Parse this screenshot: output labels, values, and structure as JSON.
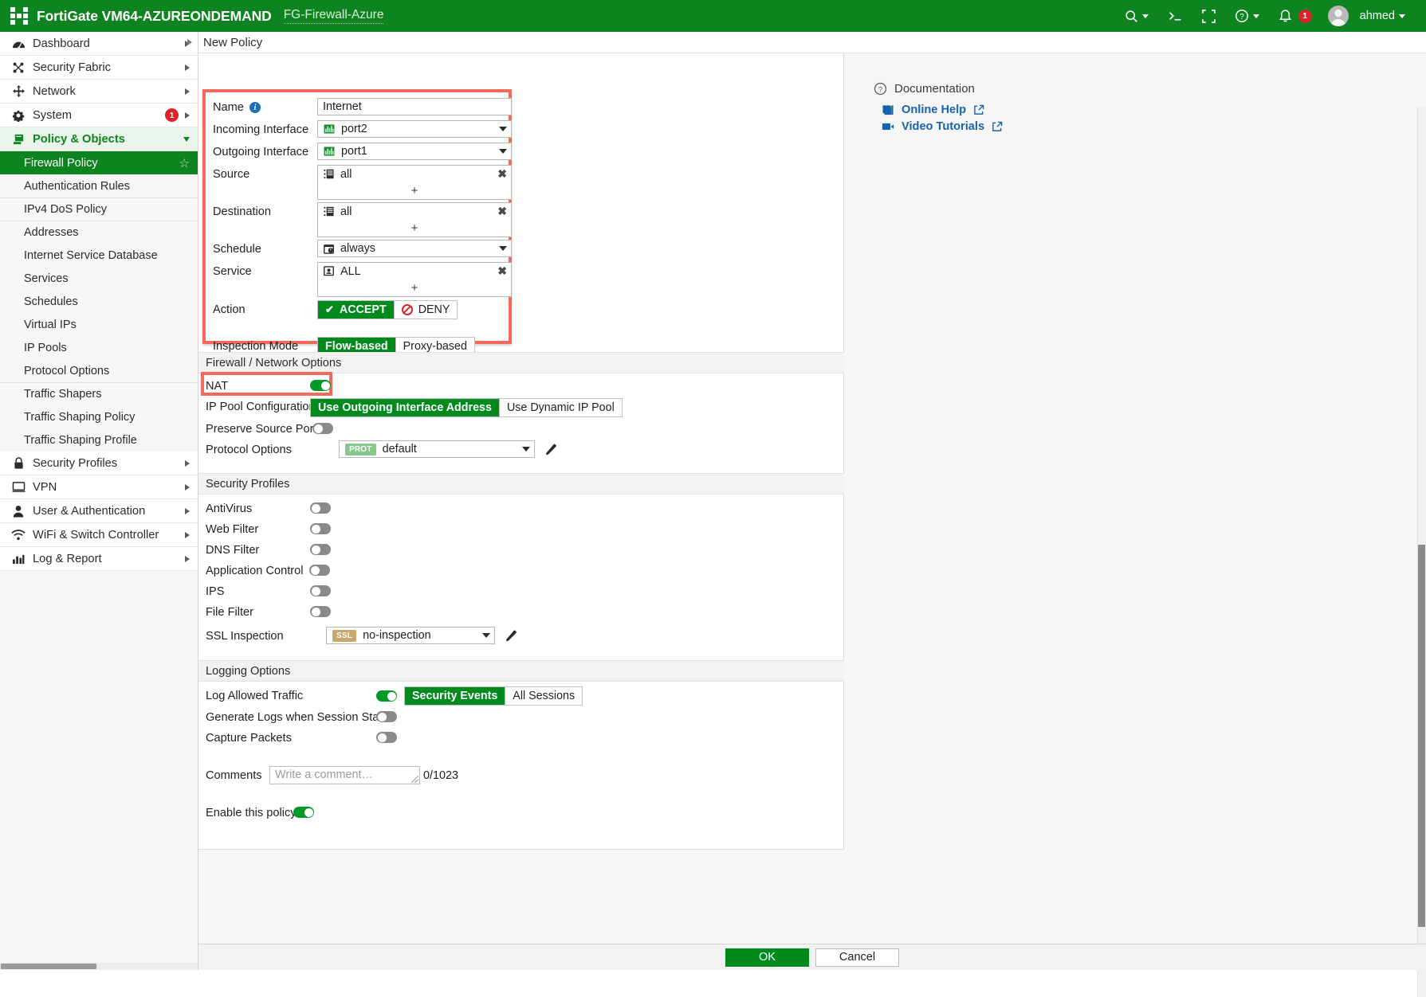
{
  "topbar": {
    "brand": "FortiGate VM64-AZUREONDEMAND",
    "hostname": "FG-Firewall-Azure",
    "search_icon": "search-icon",
    "cli_icon": "cli-console-icon",
    "fullscreen_icon": "fullscreen-icon",
    "help_icon": "help-icon",
    "notification_icon": "bell-icon",
    "notification_count": "1",
    "user_name": "ahmed"
  },
  "sidebar": {
    "top_items": [
      {
        "label": "Dashboard",
        "icon": "dashboard-icon",
        "expandable": true
      },
      {
        "label": "Security Fabric",
        "icon": "security-fabric-icon",
        "expandable": true
      },
      {
        "label": "Network",
        "icon": "network-icon",
        "expandable": true
      },
      {
        "label": "System",
        "icon": "gear-icon",
        "expandable": true,
        "badge": "1"
      },
      {
        "label": "Policy & Objects",
        "icon": "policy-objects-icon",
        "expanded": true
      }
    ],
    "sub_items": [
      {
        "label": "Firewall Policy",
        "selected": true,
        "star": "☆"
      },
      {
        "label": "Authentication Rules"
      },
      {
        "label": "IPv4 DoS Policy"
      },
      {
        "label": "Addresses"
      },
      {
        "label": "Internet Service Database"
      },
      {
        "label": "Services"
      },
      {
        "label": "Schedules"
      },
      {
        "label": "Virtual IPs"
      },
      {
        "label": "IP Pools"
      },
      {
        "label": "Protocol Options"
      },
      {
        "label": "Traffic Shapers"
      },
      {
        "label": "Traffic Shaping Policy"
      },
      {
        "label": "Traffic Shaping Profile"
      }
    ],
    "bottom_items": [
      {
        "label": "Security Profiles",
        "icon": "lock-icon",
        "expandable": true
      },
      {
        "label": "VPN",
        "icon": "monitor-icon",
        "expandable": true
      },
      {
        "label": "User & Authentication",
        "icon": "user-icon",
        "expandable": true
      },
      {
        "label": "WiFi & Switch Controller",
        "icon": "wifi-icon",
        "expandable": true
      },
      {
        "label": "Log & Report",
        "icon": "chart-bars-icon",
        "expandable": true
      }
    ]
  },
  "page": {
    "title": "New Policy"
  },
  "form": {
    "name_label": "Name",
    "name_value": "Internet",
    "incoming_label": "Incoming Interface",
    "incoming_value": "port2",
    "outgoing_label": "Outgoing Interface",
    "outgoing_value": "port1",
    "source_label": "Source",
    "source_value": "all",
    "destination_label": "Destination",
    "destination_value": "all",
    "schedule_label": "Schedule",
    "schedule_value": "always",
    "service_label": "Service",
    "service_value": "ALL",
    "action_label": "Action",
    "action_accept": "ACCEPT",
    "action_deny": "DENY",
    "action_selected": "ACCEPT",
    "inspection_label": "Inspection Mode",
    "inspection_flow": "Flow-based",
    "inspection_proxy": "Proxy-based",
    "inspection_selected": "Flow-based",
    "add_glyph": "+",
    "remove_glyph": "✖"
  },
  "network_options": {
    "section_title": "Firewall / Network Options",
    "nat_label": "NAT",
    "nat_on": true,
    "ip_pool_label": "IP Pool Configuration",
    "ip_pool_opt1": "Use Outgoing Interface Address",
    "ip_pool_opt2": "Use Dynamic IP Pool",
    "ip_pool_selected": "Use Outgoing Interface Address",
    "preserve_label": "Preserve Source Port",
    "preserve_on": false,
    "protocol_label": "Protocol Options",
    "protocol_tag": "PROT",
    "protocol_value": "default"
  },
  "security_profiles": {
    "section_title": "Security Profiles",
    "items": [
      {
        "label": "AntiVirus",
        "on": false
      },
      {
        "label": "Web Filter",
        "on": false
      },
      {
        "label": "DNS Filter",
        "on": false
      },
      {
        "label": "Application Control",
        "on": false
      },
      {
        "label": "IPS",
        "on": false
      },
      {
        "label": "File Filter",
        "on": false
      }
    ],
    "ssl_label": "SSL Inspection",
    "ssl_tag": "SSL",
    "ssl_value": "no-inspection"
  },
  "logging": {
    "section_title": "Logging Options",
    "log_allowed_label": "Log Allowed Traffic",
    "log_allowed_on": true,
    "log_opt1": "Security Events",
    "log_opt2": "All Sessions",
    "log_selected": "Security Events",
    "generate_logs_label": "Generate Logs when Session Starts",
    "generate_logs_on": false,
    "capture_packets_label": "Capture Packets",
    "capture_packets_on": false
  },
  "comments": {
    "label": "Comments",
    "placeholder": "Write a comment…",
    "value": "",
    "counter": "0/1023"
  },
  "enable_policy": {
    "label": "Enable this policy",
    "on": true
  },
  "documentation": {
    "title": "Documentation",
    "help_icon": "help-circle-icon",
    "links": [
      {
        "label": "Online Help",
        "icon": "book-icon",
        "external": "external-link-icon"
      },
      {
        "label": "Video Tutorials",
        "icon": "video-icon",
        "external": "external-link-icon"
      }
    ]
  },
  "footer": {
    "ok_label": "OK",
    "cancel_label": "Cancel"
  },
  "colors": {
    "brand_green": "#0e8420",
    "accent_green": "#008a1e",
    "highlight_red": "#f4695c",
    "link_blue": "#1864ab",
    "badge_red": "#d9252a"
  }
}
